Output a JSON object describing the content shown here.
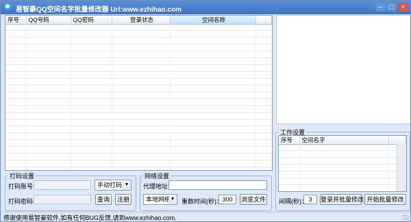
{
  "window": {
    "title": "易智豪QQ空间名字批量修改器 Url:www.ezhihao.com",
    "min_glyph": "–",
    "max_glyph": "□",
    "close_glyph": "×"
  },
  "account_table": {
    "columns": [
      "序号",
      "QQ号码",
      "QQ密码",
      "登录状态",
      "空间名称"
    ],
    "rows": []
  },
  "captcha_settings": {
    "title": "打码设置",
    "account_label": "打码账号：",
    "account_value": "",
    "password_label": "打码密码：",
    "password_value": "",
    "mode_selected": "手动打码",
    "query_button": "查询",
    "register_button": "注册"
  },
  "network_settings": {
    "title": "网络设置",
    "proxy_label": "代理地址：",
    "proxy_value": "",
    "network_selected": "本地网络",
    "retry_label": "重数时间(秒)：",
    "retry_value": "300",
    "browse_button": "浏览文件"
  },
  "work_settings": {
    "title": "工作设置",
    "columns": [
      "序号",
      "空间名字"
    ],
    "rows": [],
    "interval_label": "间隔(秒)：",
    "interval_value": "3",
    "login_modify_button": "登录并批量修改",
    "start_modify_button": "开始批量修改"
  },
  "status_bar": {
    "text": "感谢使用易智豪软件,如有任何BUG反馈,请到www.ezhihao.com."
  },
  "colors": {
    "title_bar": "#3f73c2",
    "window_bg": "#dfe8f6",
    "close_button": "#d9534f"
  }
}
